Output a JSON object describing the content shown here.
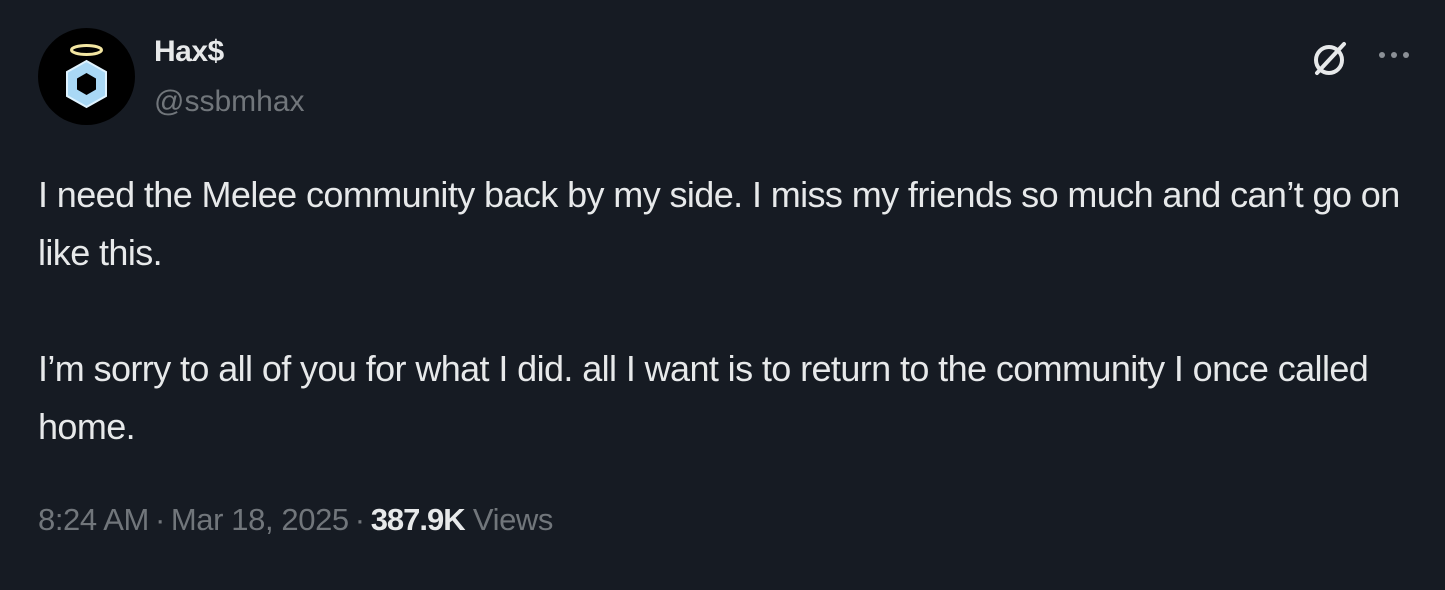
{
  "author": {
    "display_name": "Hax$",
    "handle": "@ssbmhax"
  },
  "icons": {
    "avatar": "halo-hexagon-avatar",
    "grok": "grok-icon",
    "more": "more-icon"
  },
  "tweet": {
    "paragraphs": [
      "I need the Melee community back by my side. I miss my friends so much and can’t go on like this.",
      "I’m sorry to all of you for what I did. all I want is to return to the community I once called home."
    ],
    "time": "8:24 AM",
    "separator": "·",
    "date": "Mar 18, 2025",
    "views_count": "387.9K",
    "views_label": "Views"
  },
  "colors": {
    "background": "#161b23",
    "text": "#e7e9ea",
    "muted": "#71767b",
    "avatar_hex": "#a9d8f5",
    "avatar_halo": "#f3e6a2"
  }
}
